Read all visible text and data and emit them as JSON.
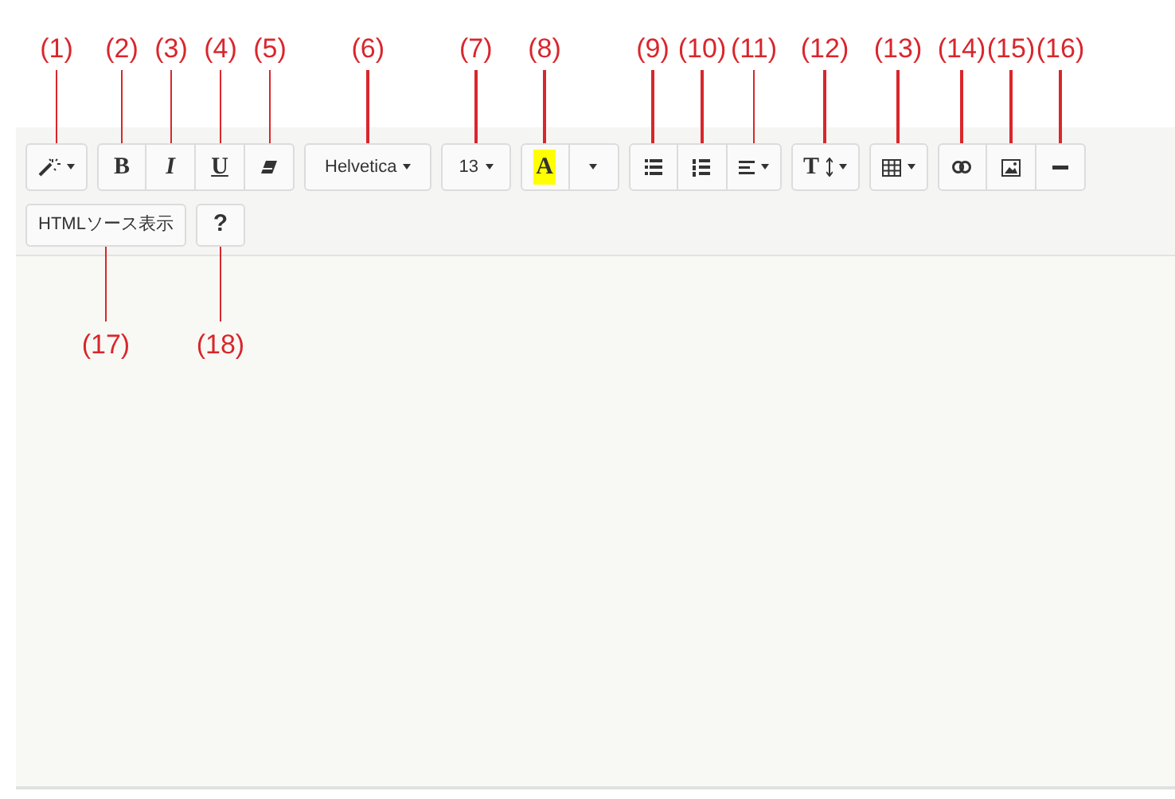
{
  "toolbar": {
    "rows": [
      [
        {
          "buttons": [
            {
              "kind": "magic",
              "callout": "(1)",
              "caret": true
            }
          ]
        },
        {
          "buttons": [
            {
              "kind": "bold",
              "label": "B",
              "callout": "(2)"
            },
            {
              "kind": "italic",
              "label": "I",
              "callout": "(3)"
            },
            {
              "kind": "underline",
              "label": "U",
              "callout": "(4)"
            },
            {
              "kind": "eraser",
              "callout": "(5)"
            }
          ]
        },
        {
          "buttons": [
            {
              "kind": "font",
              "label": "Helvetica",
              "callout": "(6)",
              "caret": true
            }
          ]
        },
        {
          "buttons": [
            {
              "kind": "size",
              "label": "13",
              "callout": "(7)",
              "caret": true
            }
          ]
        },
        {
          "buttons": [
            {
              "kind": "color",
              "label": "A",
              "callout": "(8)"
            },
            {
              "kind": "caret-only",
              "caret": true
            }
          ]
        },
        {
          "buttons": [
            {
              "kind": "ul",
              "callout": "(9)"
            },
            {
              "kind": "ol",
              "callout": "(10)"
            },
            {
              "kind": "align",
              "callout": "(11)",
              "caret": true
            }
          ]
        },
        {
          "buttons": [
            {
              "kind": "height",
              "label": "T",
              "callout": "(12)",
              "caret": true
            }
          ]
        },
        {
          "buttons": [
            {
              "kind": "table",
              "callout": "(13)",
              "caret": true
            }
          ]
        },
        {
          "buttons": [
            {
              "kind": "link",
              "callout": "(14)"
            },
            {
              "kind": "picture",
              "callout": "(15)"
            },
            {
              "kind": "hr",
              "callout": "(16)"
            }
          ]
        }
      ],
      [
        {
          "buttons": [
            {
              "kind": "text",
              "label": "HTMLソース表示",
              "callout": "(17)"
            }
          ]
        },
        {
          "buttons": [
            {
              "kind": "help",
              "label": "?",
              "callout": "(18)"
            }
          ]
        }
      ]
    ]
  }
}
